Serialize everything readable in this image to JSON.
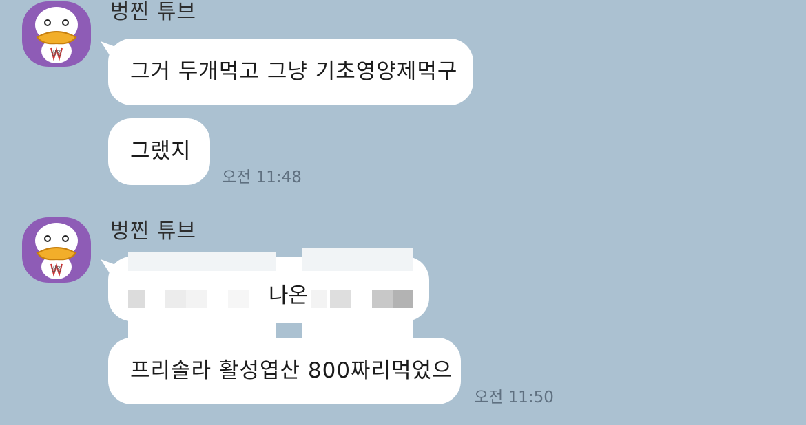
{
  "messages": [
    {
      "sender": "벙찐 튜브",
      "bubbles": [
        {
          "text": "그거 두개먹고 그냥 기초영양제먹구"
        },
        {
          "text": "그랬지",
          "time": "오전 11:48"
        }
      ]
    },
    {
      "sender": "벙찐 튜브",
      "bubbles": [
        {
          "visible_text": "나온",
          "censored": true
        },
        {
          "text": "프리솔라 활성엽산 800짜리먹었으",
          "time": "오전 11:50"
        }
      ]
    }
  ],
  "avatar": {
    "icon": "duck-character-icon",
    "color": "#8e5cb6"
  },
  "colors": {
    "background": "#abc1d1",
    "bubble": "#ffffff",
    "time_text": "#5f7080"
  }
}
